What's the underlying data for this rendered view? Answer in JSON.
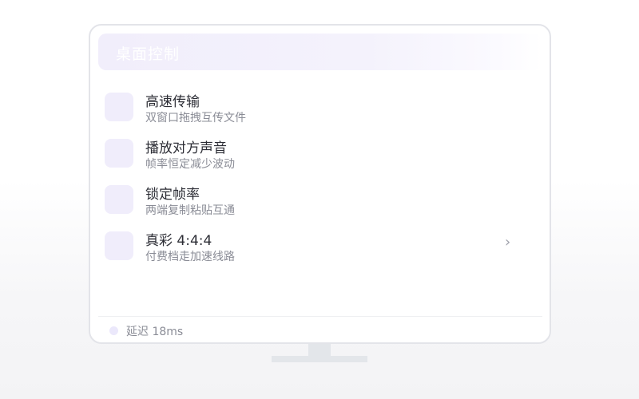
{
  "header": {
    "title": "桌面控制"
  },
  "features": [
    {
      "title": "高速传输",
      "subtitle": "双窗口拖拽互传文件",
      "icon": "feature-tile-icon"
    },
    {
      "title": "播放对方声音",
      "subtitle": "帧率恒定减少波动",
      "icon": "feature-tile-icon"
    },
    {
      "title": "锁定帧率",
      "subtitle": "两端复制粘贴互通",
      "icon": "feature-tile-icon"
    },
    {
      "title": "真彩 4:4:4",
      "subtitle": "付费档走加速线路",
      "icon": "feature-tile-icon",
      "chevron": "›"
    }
  ],
  "status": {
    "latency_text": "延迟 18ms"
  },
  "colors": {
    "accent_tint": "#f0edfb",
    "text_primary": "#2c2d35",
    "text_secondary": "#8a8c96",
    "monitor_border": "#e3e4e9"
  }
}
